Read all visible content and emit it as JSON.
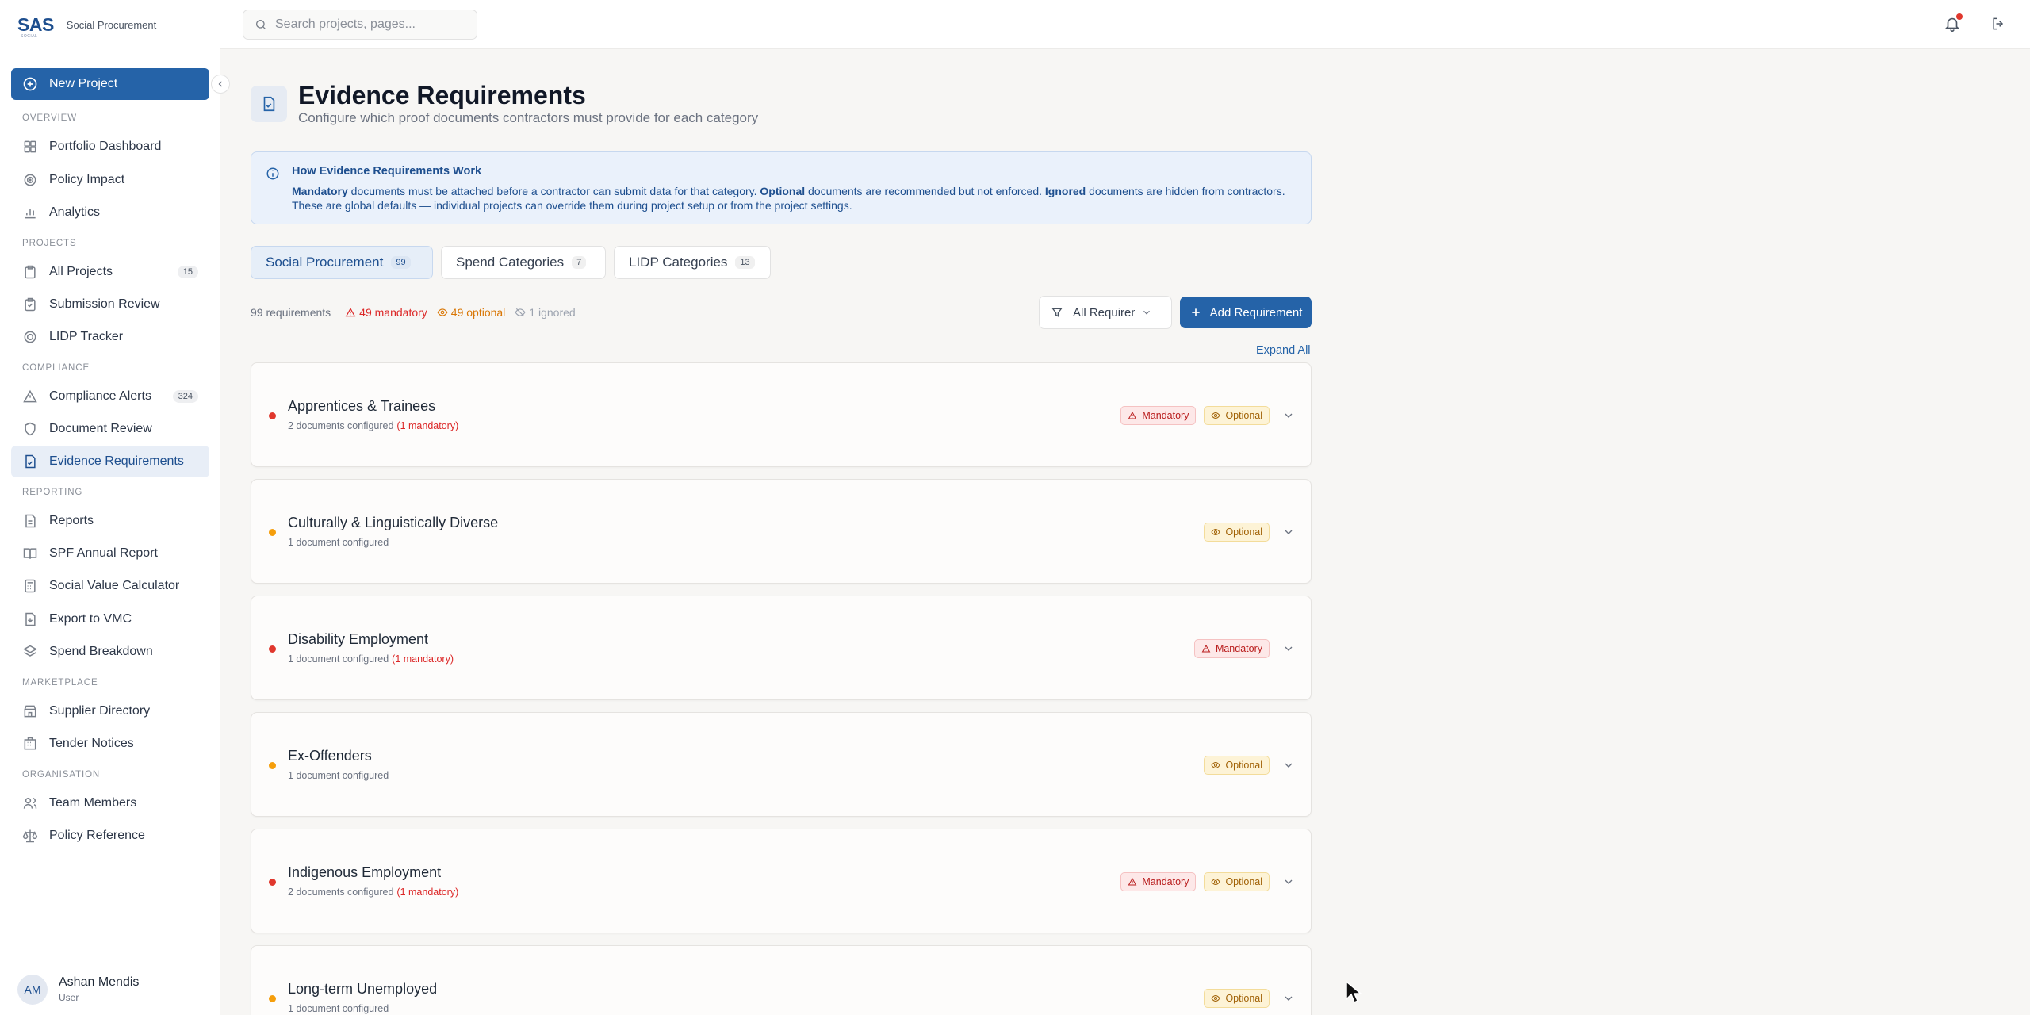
{
  "brand": {
    "logo": "SAS",
    "logo_sub": "SOCIAL",
    "name": "Social Procurement"
  },
  "sidebar": {
    "new_project": "New Project",
    "sections": {
      "overview": "OVERVIEW",
      "projects": "PROJECTS",
      "compliance": "COMPLIANCE",
      "reporting": "REPORTING",
      "marketplace": "MARKETPLACE",
      "organisation": "ORGANISATION"
    },
    "items": {
      "portfolio_dashboard": "Portfolio Dashboard",
      "policy_impact": "Policy Impact",
      "analytics": "Analytics",
      "all_projects": "All Projects",
      "all_projects_count": "15",
      "submission_review": "Submission Review",
      "lidp_tracker": "LIDP Tracker",
      "compliance_alerts": "Compliance Alerts",
      "compliance_alerts_count": "324",
      "document_review": "Document Review",
      "evidence_requirements": "Evidence Requirements",
      "reports": "Reports",
      "spf_annual_report": "SPF Annual Report",
      "social_value_calculator": "Social Value Calculator",
      "export_to_vmc": "Export to VMC",
      "spend_breakdown": "Spend Breakdown",
      "supplier_directory": "Supplier Directory",
      "tender_notices": "Tender Notices",
      "team_members": "Team Members",
      "policy_reference": "Policy Reference"
    },
    "user": {
      "initials": "AM",
      "name": "Ashan Mendis",
      "role": "User"
    }
  },
  "topbar": {
    "search_placeholder": "Search projects, pages..."
  },
  "page": {
    "title": "Evidence Requirements",
    "subtitle": "Configure which proof documents contractors must provide for each category"
  },
  "info": {
    "title": "How Evidence Requirements Work",
    "mandatory_word": "Mandatory",
    "text_1": " documents must be attached before a contractor can submit data for that category. ",
    "optional_word": "Optional",
    "text_2": " documents are recommended but not enforced. ",
    "ignored_word": "Ignored",
    "text_3": " documents are hidden from contractors. These are global defaults — individual projects can override them during project setup or from the project settings."
  },
  "tabs": [
    {
      "label": "Social Procurement",
      "count": "99"
    },
    {
      "label": "Spend Categories",
      "count": "7"
    },
    {
      "label": "LIDP Categories",
      "count": "13"
    }
  ],
  "summary": {
    "total": "99 requirements",
    "mandatory": "49 mandatory",
    "optional": "49 optional",
    "ignored": "1 ignored"
  },
  "filter": {
    "label": "All Requirements"
  },
  "add_requirement": "Add Requirement",
  "expand_all": "Expand All",
  "badge_labels": {
    "mandatory": "Mandatory",
    "optional": "Optional"
  },
  "categories": [
    {
      "name": "Apprentices & Trainees",
      "meta": "2 documents configured",
      "meta_mandatory": "(1 mandatory)"
    },
    {
      "name": "Culturally & Linguistically Diverse",
      "meta": "1 document configured",
      "meta_mandatory": ""
    },
    {
      "name": "Disability Employment",
      "meta": "1 document configured",
      "meta_mandatory": "(1 mandatory)"
    },
    {
      "name": "Ex-Offenders",
      "meta": "1 document configured",
      "meta_mandatory": ""
    },
    {
      "name": "Indigenous Employment",
      "meta": "2 documents configured",
      "meta_mandatory": "(1 mandatory)"
    },
    {
      "name": "Long-term Unemployed",
      "meta": "1 document configured",
      "meta_mandatory": ""
    }
  ],
  "colors": {
    "accent": "#2563a8",
    "mandatory": "#dc2626",
    "optional": "#d97706"
  }
}
